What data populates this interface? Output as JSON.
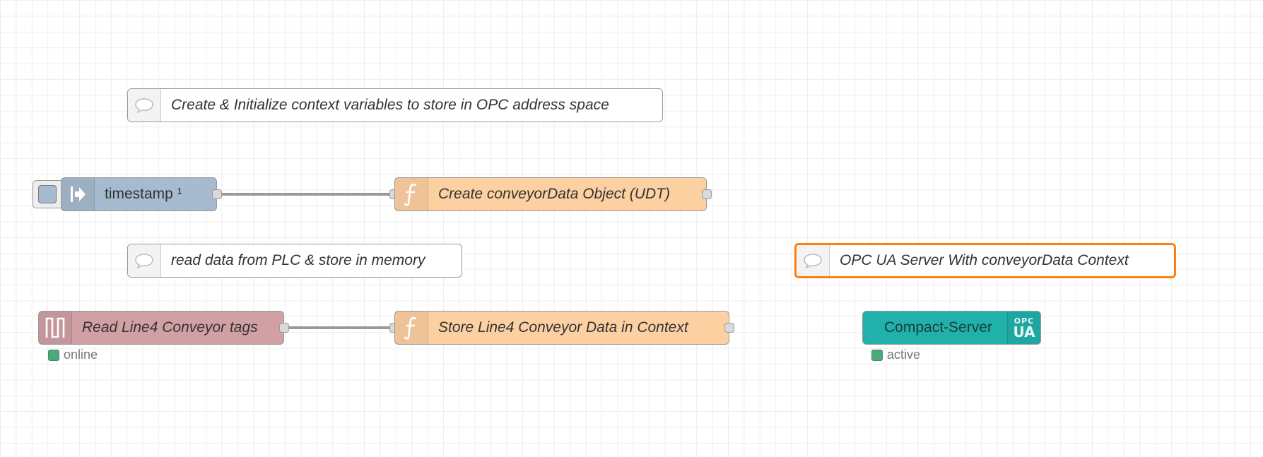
{
  "flow": {
    "comments": {
      "init": "Create & Initialize context variables to store in OPC address space",
      "read": "read data from PLC & store in memory",
      "server": "OPC UA Server With conveyorData Context"
    },
    "nodes": {
      "inject": {
        "label": "timestamp ¹",
        "type": "inject"
      },
      "create_udt": {
        "label": "Create conveyorData Object (UDT)",
        "type": "function"
      },
      "read_tags": {
        "label": "Read Line4 Conveyor tags",
        "type": "plc-read"
      },
      "store_data": {
        "label": "Store Line4 Conveyor Data in Context",
        "type": "function"
      },
      "opc_server": {
        "label": "Compact-Server",
        "type": "opcua-server",
        "badge_top": "OPC",
        "badge_bottom": "UA"
      }
    },
    "status": {
      "read_tags": {
        "text": "online",
        "color": "#4aa879"
      },
      "opc_server": {
        "text": "active",
        "color": "#4aa879"
      }
    },
    "wires": [
      {
        "from": "inject",
        "to": "create_udt"
      },
      {
        "from": "read_tags",
        "to": "store_data"
      }
    ]
  },
  "colors": {
    "inject": "#a6bbcf",
    "function": "#fdd0a2",
    "plc": "#d1a0a5",
    "opcua": "#20b1aa",
    "selection": "#ff7f0e",
    "wire": "#999999"
  },
  "icons": {
    "comment": "speech-bubble-icon",
    "inject": "arrow-inject-icon",
    "function": "function-f-icon",
    "plc": "pulse-wave-icon",
    "opcua": "opc-ua-badge-icon"
  }
}
